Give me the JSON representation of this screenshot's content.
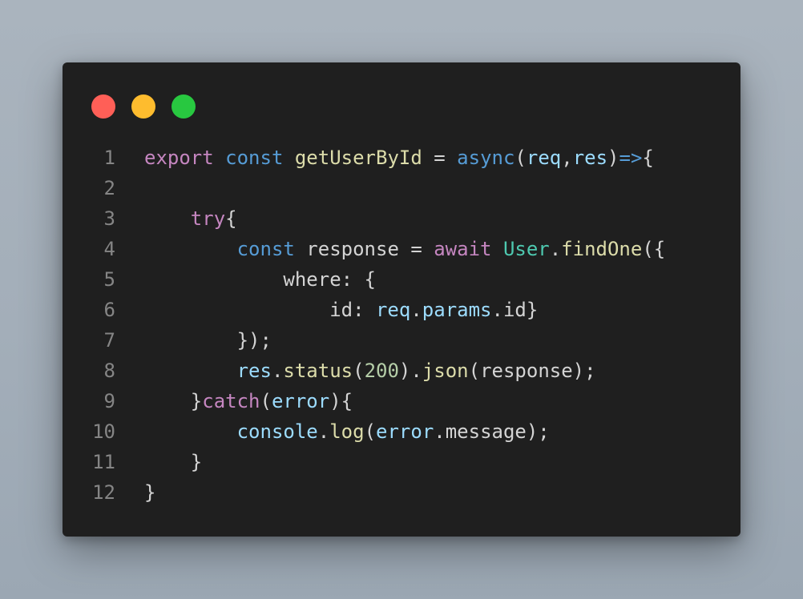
{
  "window": {
    "buttons": [
      {
        "name": "close",
        "color": "#ff5f57"
      },
      {
        "name": "minimize",
        "color": "#febc2e"
      },
      {
        "name": "maximize",
        "color": "#28c840"
      }
    ]
  },
  "colors": {
    "keyword": "#c586c0",
    "storage": "#569cd6",
    "function": "#dcdcaa",
    "variable": "#9cdcfe",
    "class": "#4ec9b0",
    "number": "#b5cea8",
    "plain": "#d4d4d4",
    "line_number": "#858585",
    "background": "#1f1f1f"
  },
  "code": {
    "lines": [
      {
        "n": "1",
        "indent": "",
        "tokens": [
          {
            "t": "export",
            "c": "kw"
          },
          {
            "t": " ",
            "c": "pl"
          },
          {
            "t": "const",
            "c": "st"
          },
          {
            "t": " ",
            "c": "pl"
          },
          {
            "t": "getUserById",
            "c": "fn"
          },
          {
            "t": " = ",
            "c": "pl"
          },
          {
            "t": "async",
            "c": "st"
          },
          {
            "t": "(",
            "c": "pl"
          },
          {
            "t": "req",
            "c": "var"
          },
          {
            "t": ",",
            "c": "pl"
          },
          {
            "t": "res",
            "c": "var"
          },
          {
            "t": ")",
            "c": "pl"
          },
          {
            "t": "=>",
            "c": "st"
          },
          {
            "t": "{",
            "c": "pl"
          }
        ]
      },
      {
        "n": "2",
        "indent": "",
        "tokens": []
      },
      {
        "n": "3",
        "indent": "    ",
        "tokens": [
          {
            "t": "try",
            "c": "kw"
          },
          {
            "t": "{",
            "c": "pl"
          }
        ]
      },
      {
        "n": "4",
        "indent": "        ",
        "tokens": [
          {
            "t": "const",
            "c": "st"
          },
          {
            "t": " response = ",
            "c": "pl"
          },
          {
            "t": "await",
            "c": "kw"
          },
          {
            "t": " ",
            "c": "pl"
          },
          {
            "t": "User",
            "c": "cls"
          },
          {
            "t": ".",
            "c": "pl"
          },
          {
            "t": "findOne",
            "c": "fn"
          },
          {
            "t": "({",
            "c": "pl"
          }
        ]
      },
      {
        "n": "5",
        "indent": "            ",
        "tokens": [
          {
            "t": "where: {",
            "c": "pl"
          }
        ]
      },
      {
        "n": "6",
        "indent": "                ",
        "tokens": [
          {
            "t": "id: ",
            "c": "pl"
          },
          {
            "t": "req",
            "c": "var"
          },
          {
            "t": ".",
            "c": "pl"
          },
          {
            "t": "params",
            "c": "var"
          },
          {
            "t": ".id}",
            "c": "pl"
          }
        ]
      },
      {
        "n": "7",
        "indent": "        ",
        "tokens": [
          {
            "t": "});",
            "c": "pl"
          }
        ]
      },
      {
        "n": "8",
        "indent": "        ",
        "tokens": [
          {
            "t": "res",
            "c": "var"
          },
          {
            "t": ".",
            "c": "pl"
          },
          {
            "t": "status",
            "c": "fn"
          },
          {
            "t": "(",
            "c": "pl"
          },
          {
            "t": "200",
            "c": "num"
          },
          {
            "t": ").",
            "c": "pl"
          },
          {
            "t": "json",
            "c": "fn"
          },
          {
            "t": "(response);",
            "c": "pl"
          }
        ]
      },
      {
        "n": "9",
        "indent": "    ",
        "tokens": [
          {
            "t": "}",
            "c": "pl"
          },
          {
            "t": "catch",
            "c": "kw"
          },
          {
            "t": "(",
            "c": "pl"
          },
          {
            "t": "error",
            "c": "var"
          },
          {
            "t": "){",
            "c": "pl"
          }
        ]
      },
      {
        "n": "10",
        "indent": "        ",
        "tokens": [
          {
            "t": "console",
            "c": "var"
          },
          {
            "t": ".",
            "c": "pl"
          },
          {
            "t": "log",
            "c": "fn"
          },
          {
            "t": "(",
            "c": "pl"
          },
          {
            "t": "error",
            "c": "var"
          },
          {
            "t": ".message);",
            "c": "pl"
          }
        ]
      },
      {
        "n": "11",
        "indent": "    ",
        "tokens": [
          {
            "t": "}",
            "c": "pl"
          }
        ]
      },
      {
        "n": "12",
        "indent": "",
        "tokens": [
          {
            "t": "}",
            "c": "pl"
          }
        ]
      }
    ]
  }
}
